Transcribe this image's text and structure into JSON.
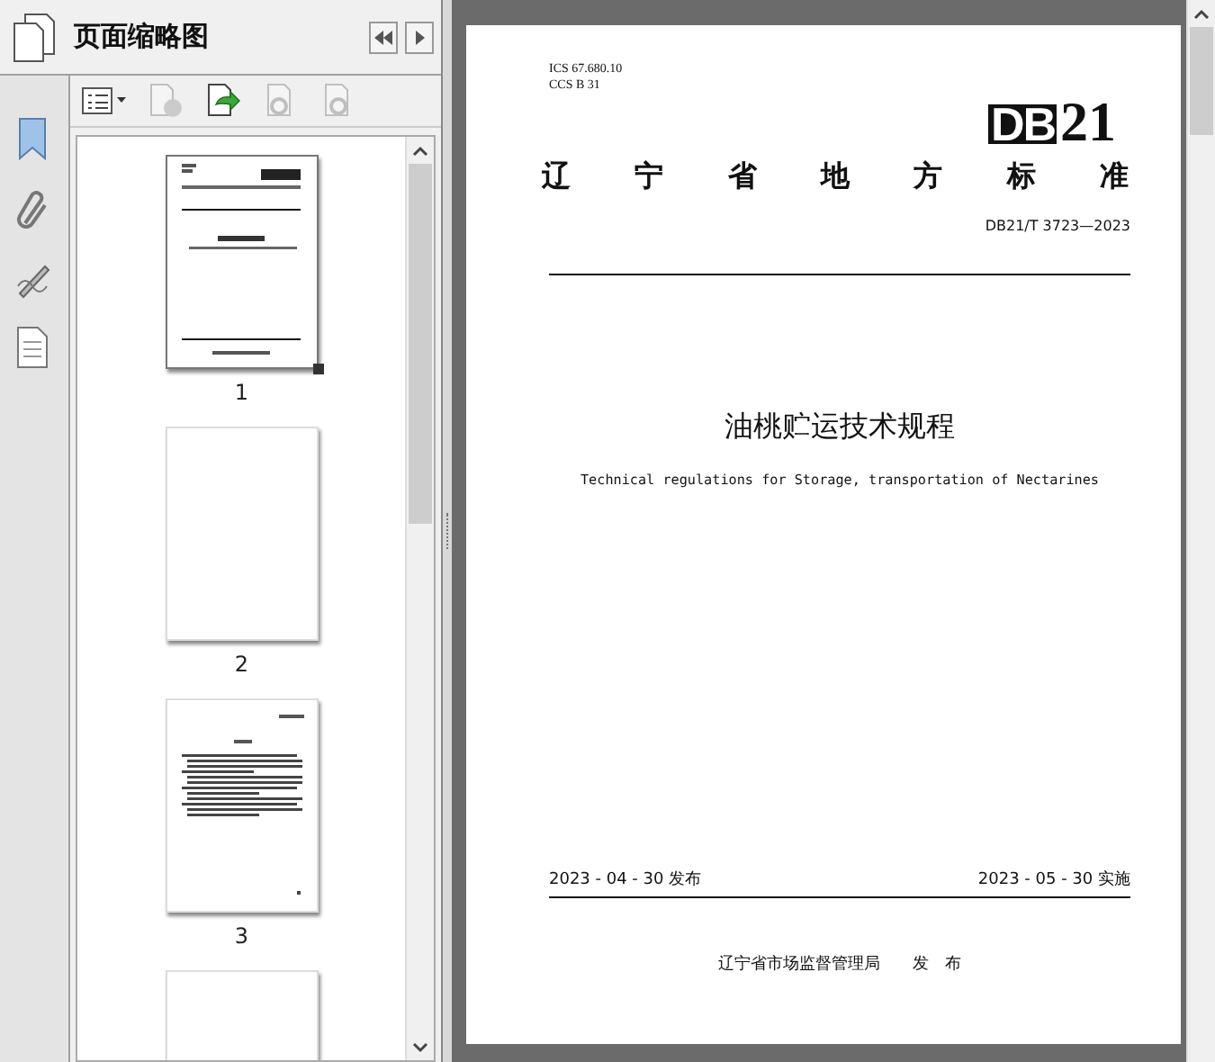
{
  "panel": {
    "title": "页面缩略图"
  },
  "thumbnails": [
    {
      "kind": "cover",
      "label": "1",
      "selected": true
    },
    {
      "kind": "blank",
      "label": "2",
      "selected": false
    },
    {
      "kind": "text",
      "label": "3",
      "selected": false
    },
    {
      "kind": "blank",
      "selected": false
    }
  ],
  "document": {
    "ics": "ICS  67.680.10",
    "ccs": "CCS  B  31",
    "logo_block": "DB",
    "logo_number": "21",
    "standard_type": "辽 宁 省 地 方 标 准",
    "code": "DB21/T  3723—2023",
    "title_cn": "油桃贮运技术规程",
    "title_en": "Technical regulations for Storage, transportation of Nectarines",
    "issue_date": "2023 - 04 - 30 发布",
    "effective_date": "2023 - 05 - 30 实施",
    "issuer": "辽宁省市场监督管理局　　发　布"
  }
}
